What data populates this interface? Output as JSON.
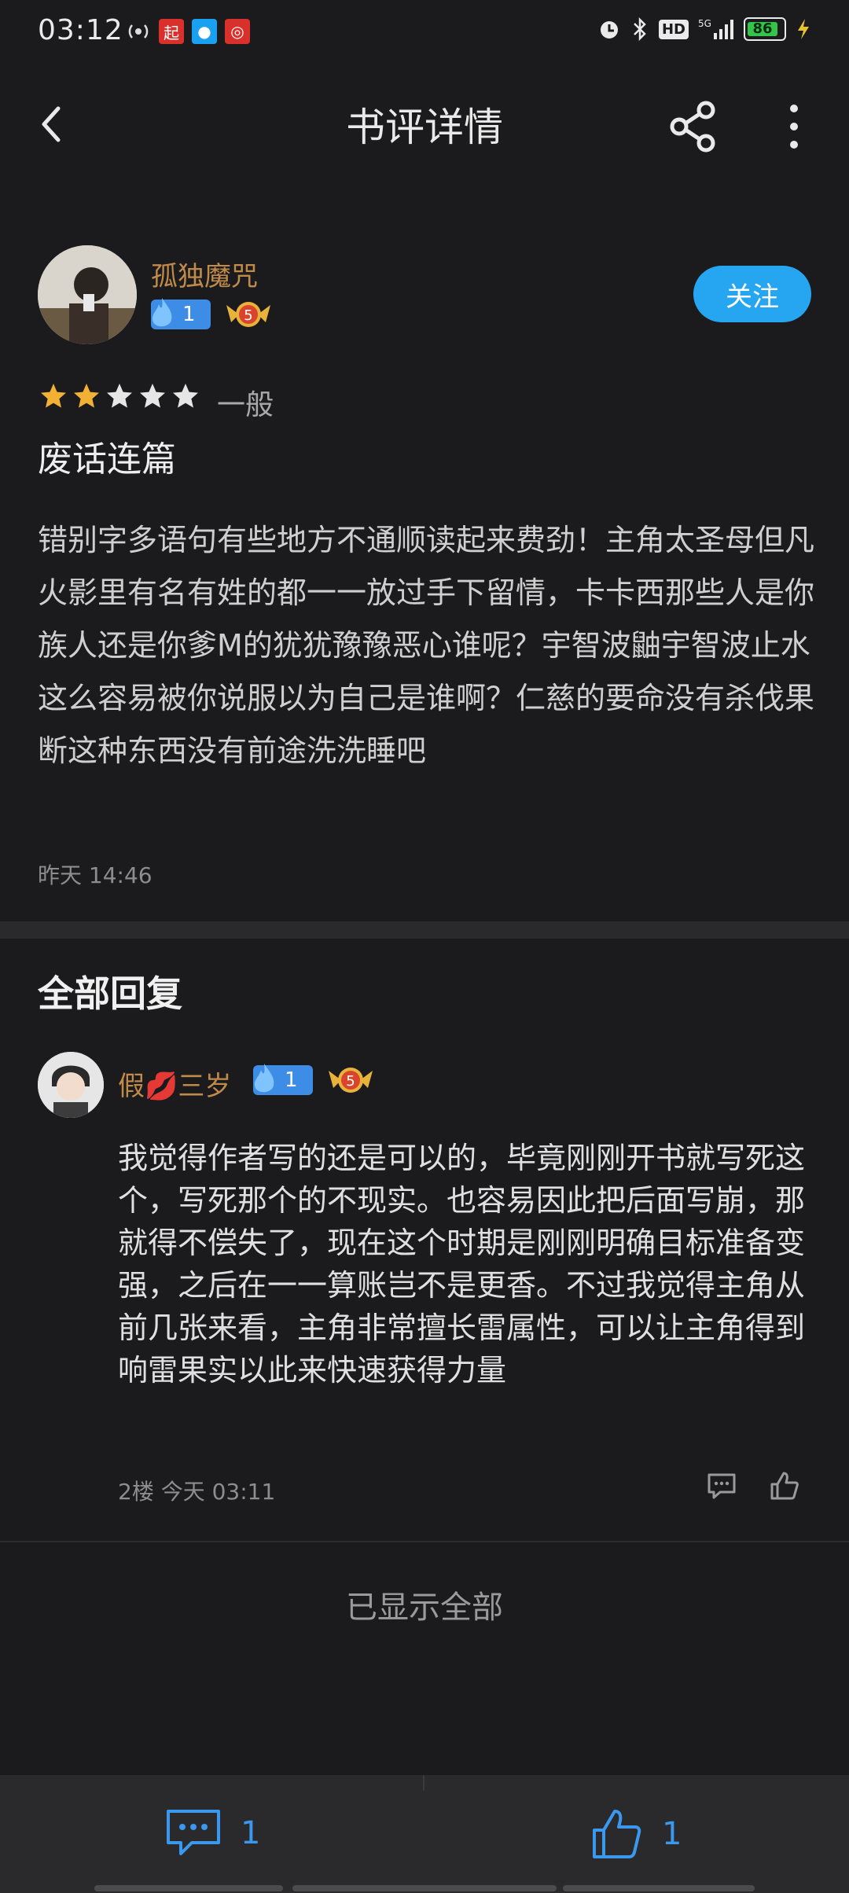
{
  "status_bar": {
    "time": "03:12",
    "left_icons": [
      "hotspot-icon",
      "qidian-app-icon",
      "qq-icon",
      "netease-music-icon"
    ],
    "right_icons": [
      "alarm-icon",
      "bluetooth-icon",
      "hd-icon",
      "5g-signal-icon"
    ],
    "battery": "86"
  },
  "header": {
    "title": "书评详情"
  },
  "review": {
    "author": "孤独魔咒",
    "fire_level": "1",
    "medal_level": "5",
    "follow_label": "关注",
    "rating_label": "一般",
    "stars_filled": 2,
    "stars_total": 5,
    "title": "废话连篇",
    "body": "错别字多语句有些地方不通顺读起来费劲！主角太圣母但凡火影里有名有姓的都一一放过手下留情，卡卡西那些人是你族人还是你爹M的犹犹豫豫恶心谁呢？宇智波鼬宇智波止水这么容易被你说服以为自己是谁啊？仁慈的要命没有杀伐果断这种东西没有前途洗洗睡吧",
    "time": "昨天 14:46"
  },
  "replies": {
    "section_title": "全部回复",
    "items": [
      {
        "name": "假💋三岁",
        "fire_level": "1",
        "medal_level": "5",
        "body": "我觉得作者写的还是可以的，毕竟刚刚开书就写死这个，写死那个的不现实。也容易因此把后面写崩，那就得不偿失了，现在这个时期是刚刚明确目标准备变强，之后在一一算账岂不是更香。不过我觉得主角从前几张来看，主角非常擅长雷属性，可以让主角得到响雷果实以此来快速获得力量",
        "meta": "2楼 今天 03:11"
      }
    ],
    "end_label": "已显示全部"
  },
  "bottom_bar": {
    "comment_count": "1",
    "like_count": "1",
    "accent": "#3a98ef"
  }
}
